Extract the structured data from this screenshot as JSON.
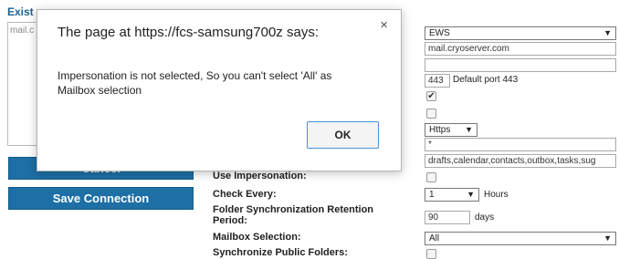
{
  "left_panel": {
    "title": "Exist",
    "list_items": [
      "mail.c"
    ],
    "cancel_label": "Cancel",
    "save_label": "Save Connection"
  },
  "form": {
    "server_type": "EWS",
    "server_address": "mail.cryoserver.com",
    "blank_field": "",
    "port": "443",
    "port_note": "Default port 443",
    "checked_option": true,
    "unchecked_option": false,
    "protocol": "Https",
    "star_field": "*",
    "folders": "drafts,calendar,contacts,outbox,tasks,sug",
    "use_impersonation_label": "Use Impersonation:",
    "check_every_label": "Check Every:",
    "check_every_value": "1",
    "check_every_unit": "Hours",
    "retention_label_1": "Folder Synchronization Retention",
    "retention_label_2": "Period:",
    "retention_value": "90",
    "retention_unit": "days",
    "mailbox_selection_label": "Mailbox Selection:",
    "mailbox_selection_value": "All",
    "sync_public_label": "Synchronize Public Folders:"
  },
  "dialog": {
    "title": "The page at https://fcs-samsung700z says:",
    "message": "Impersonation is not selected, So you can't select 'All' as Mailbox selection",
    "ok_label": "OK",
    "close_glyph": "×"
  }
}
